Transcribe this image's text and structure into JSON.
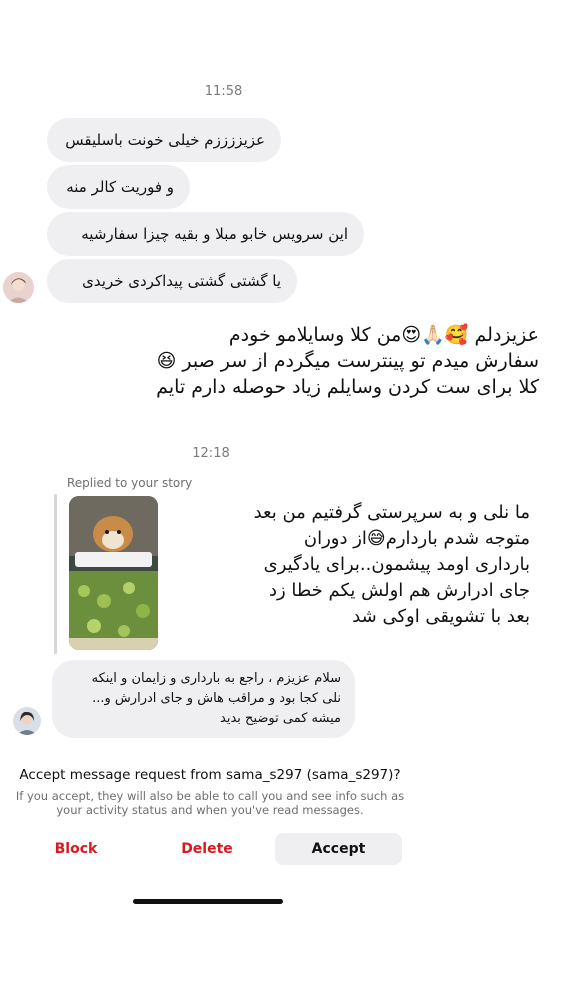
{
  "timestamps": {
    "first": "11:58",
    "second": "12:18"
  },
  "incoming_messages": [
    "عزیززززم خیلی خونت باسلیقس",
    "و فوریت کالر منه",
    "این سرویس خابو مبلا و بقیه چیزا سفارشیه",
    "یا گشتی گشتی پیداکردی خریدی"
  ],
  "outgoing_note": "عزیزدلم 🥰🙏🏻😍من کلا وسایلامو خودم\nسفارش میدم تو پینترست میگردم از سر صبر 😆\nکلا برای ست کردن وسایلم زیاد حوصله دارم تایم",
  "story_reply": {
    "label": "Replied to your story",
    "story_caption": "ما نلی و به سرپرستی گرفتیم من بعد\nمتوجه شدم باردارم😅از دوران\nبارداری اومد پیشمون..برای یادگیری\nجای ادرارش هم اولش یکم خطا زد\nبعد با تشویقی اوکی شد",
    "message": "سلام عزیزم ، راجع به بارداری و زایمان و اینکه\nنلی کجا بود و مراقب هاش و جای ادرارش و...\nمیشه کمی توضیح بدید"
  },
  "request": {
    "title": "Accept message request from sama_s297 (sama_s297)?",
    "body": "If you accept, they will also be able to call you and see info such as\nyour activity status and when you've read messages.",
    "block_label": "Block",
    "delete_label": "Delete",
    "accept_label": "Accept"
  },
  "colors": {
    "danger": "#d71920",
    "bubble": "#efeff1"
  }
}
